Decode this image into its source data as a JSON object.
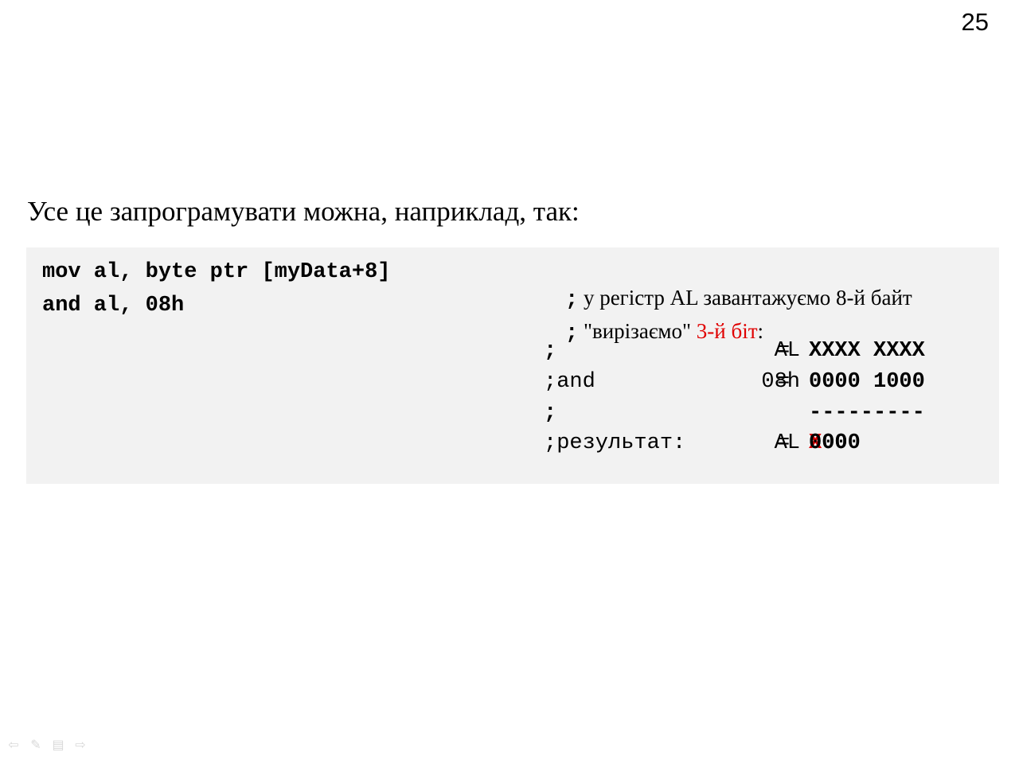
{
  "slide_number": "25",
  "intro_text": "Усе це запрограмувати можна, наприклад, так:",
  "code": {
    "lines": [
      "mov al, byte ptr [myData+8]",
      "and al, 08h"
    ],
    "comments": {
      "line1_semicolon": ";",
      "line1_text": " у регістр AL завантажуємо 8-й байт",
      "line2_semicolon": ";",
      "line2_text_before": " \"вирізаємо\" ",
      "line2_highlight": "3-й біт",
      "line2_text_after": ":"
    },
    "calculation": {
      "row1": {
        "prefix": ";",
        "reg": "AL",
        "eq": "=",
        "value": "XXXX XXXX"
      },
      "row2": {
        "prefix": ";and",
        "reg": "08h",
        "eq": "=",
        "value": "0000 1000"
      },
      "row3": {
        "prefix": ";",
        "value": "---------"
      },
      "row4": {
        "prefix": ";результат:",
        "reg": "AL",
        "eq": "=",
        "value_before": "0000 ",
        "value_highlight": "X",
        "value_after": "000"
      }
    }
  },
  "colors": {
    "highlight": "#e00000",
    "code_background": "#f2f2f2"
  },
  "nav_icons": [
    "arrow-left-icon",
    "pen-icon",
    "menu-icon",
    "arrow-right-icon"
  ]
}
